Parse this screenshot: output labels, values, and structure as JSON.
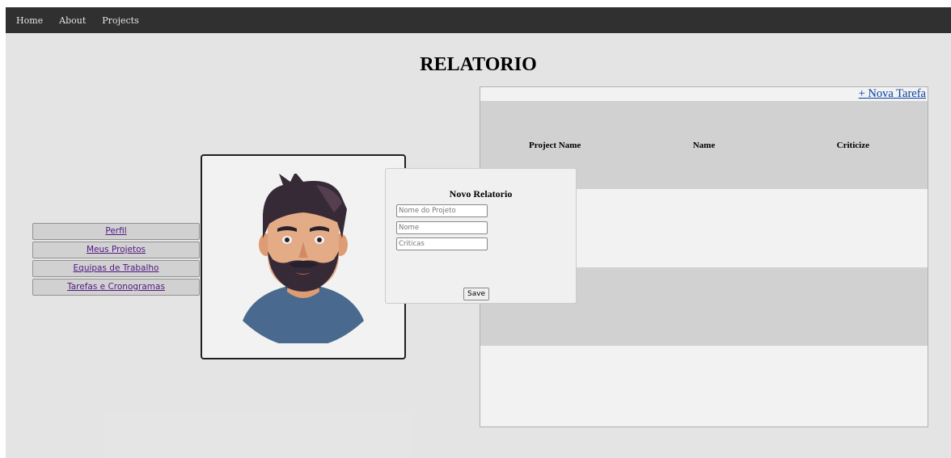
{
  "navbar": {
    "items": [
      "Home",
      "About",
      "Projects"
    ]
  },
  "page": {
    "title": "RELATORIO"
  },
  "sidebar": {
    "items": [
      {
        "label": "Perfil"
      },
      {
        "label": "Meus Projetos"
      },
      {
        "label": "Equipas de Trabalho"
      },
      {
        "label": "Tarefas e Cronogramas"
      }
    ]
  },
  "report_table": {
    "add_link": "+ Nova Tarefa",
    "columns": [
      "Project Name",
      "Name",
      "Criticize"
    ]
  },
  "modal": {
    "title": "Novo Relatorio",
    "fields": [
      {
        "placeholder": "Nome do Projeto",
        "value": ""
      },
      {
        "placeholder": "Nome",
        "value": ""
      },
      {
        "placeholder": "Criticas",
        "value": ""
      }
    ],
    "save_label": "Save"
  },
  "colors": {
    "navbar_bg": "#333333",
    "link_visited": "#551a8b",
    "link": "#0645ad",
    "row_shade": "#dddddd"
  },
  "icons": {
    "avatar": "bearded-man-avatar"
  }
}
